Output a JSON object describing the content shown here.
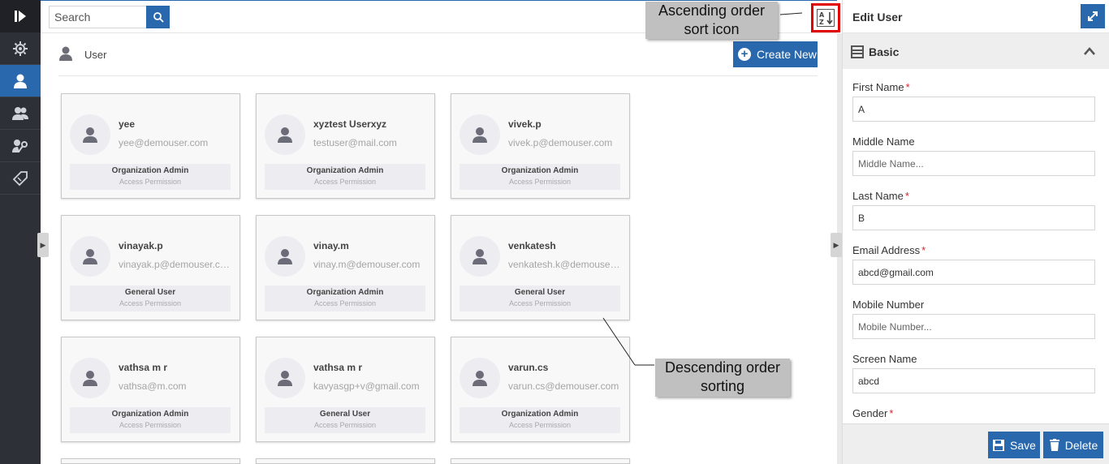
{
  "search": {
    "placeholder": "Search"
  },
  "section": {
    "title": "User",
    "create_label": "Create New"
  },
  "users": [
    {
      "name": "yee",
      "email": "yee@demouser.com",
      "role": "Organization Admin",
      "permission": "Access Permission"
    },
    {
      "name": "xyztest Userxyz",
      "email": "testuser@mail.com",
      "role": "Organization Admin",
      "permission": "Access Permission"
    },
    {
      "name": "vivek.p",
      "email": "vivek.p@demouser.com",
      "role": "Organization Admin",
      "permission": "Access Permission"
    },
    {
      "name": "vinayak.p",
      "email": "vinayak.p@demouser.com",
      "role": "General User",
      "permission": "Access Permission"
    },
    {
      "name": "vinay.m",
      "email": "vinay.m@demouser.com",
      "role": "Organization Admin",
      "permission": "Access Permission"
    },
    {
      "name": "venkatesh",
      "email": "venkatesh.k@demouser.com",
      "role": "General User",
      "permission": "Access Permission"
    },
    {
      "name": "vathsa m r",
      "email": "vathsa@m.com",
      "role": "Organization Admin",
      "permission": "Access Permission"
    },
    {
      "name": "vathsa m r",
      "email": "kavyasgp+v@gmail.com",
      "role": "General User",
      "permission": "Access Permission"
    },
    {
      "name": "varun.cs",
      "email": "varun.cs@demouser.com",
      "role": "Organization Admin",
      "permission": "Access Permission"
    }
  ],
  "panel": {
    "title": "Edit User",
    "section_title": "Basic",
    "fields": {
      "first_name": {
        "label": "First Name",
        "value": "A",
        "required": "*"
      },
      "middle_name": {
        "label": "Middle Name",
        "placeholder": "Middle Name..."
      },
      "last_name": {
        "label": "Last Name",
        "value": "B",
        "required": "*"
      },
      "email": {
        "label": "Email Address",
        "value": "abcd@gmail.com",
        "required": "*"
      },
      "mobile": {
        "label": "Mobile Number",
        "placeholder": "Mobile Number..."
      },
      "screen_name": {
        "label": "Screen Name",
        "value": "abcd"
      },
      "gender": {
        "label": "Gender",
        "required": "*"
      }
    },
    "save_label": "Save",
    "delete_label": "Delete"
  },
  "annotations": {
    "ascending_line1": "Ascending order",
    "ascending_line2": "sort icon",
    "descending_line1": "Descending order",
    "descending_line2": "sorting"
  },
  "colors": {
    "accent": "#2a68ad",
    "rail": "#2d3037",
    "highlight": "#e00000"
  }
}
